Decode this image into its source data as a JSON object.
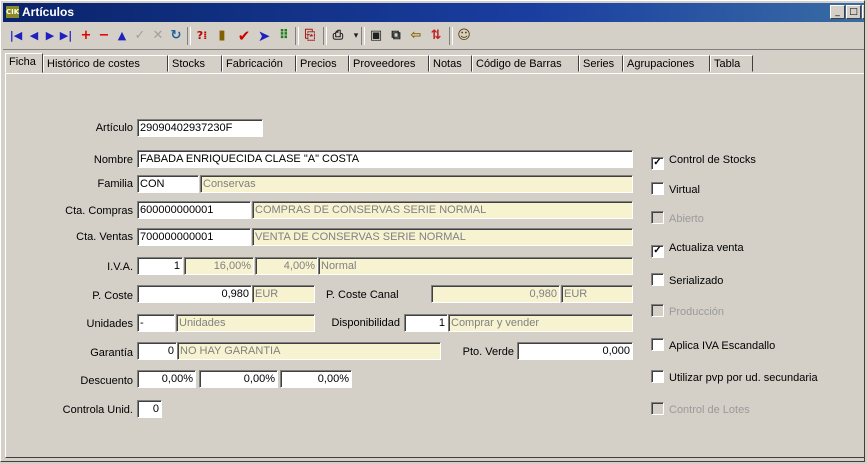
{
  "window": {
    "title": "Artículos",
    "app_icon": "CIK"
  },
  "tabs": [
    "Ficha",
    "Histórico de costes",
    "Stocks",
    "Fabricación",
    "Precios",
    "Proveedores",
    "Notas",
    "Código de Barras",
    "Series",
    "Agrupaciones",
    "Tabla"
  ],
  "form": {
    "labels": {
      "articulo": "Artículo",
      "nombre": "Nombre",
      "familia": "Familia",
      "cta_compras": "Cta. Compras",
      "cta_ventas": "Cta. Ventas",
      "iva": "I.V.A.",
      "p_coste": "P. Coste",
      "p_coste_canal": "P. Coste Canal",
      "unidades": "Unidades",
      "disponibilidad": "Disponibilidad",
      "garantia": "Garantía",
      "pto_verde": "Pto. Verde",
      "descuento": "Descuento",
      "controla_unid": "Controla Unid."
    },
    "values": {
      "articulo": "29090402937230F",
      "nombre": "FABADA ENRIQUECIDA CLASE \"A\" COSTA",
      "familia_code": "CON",
      "familia_desc": "Conservas",
      "cta_compras_code": "600000000001",
      "cta_compras_desc": "COMPRAS DE CONSERVAS SERIE NORMAL",
      "cta_ventas_code": "700000000001",
      "cta_ventas_desc": "VENTA DE CONSERVAS SERIE NORMAL",
      "iva_code": "1",
      "iva_pct": "16,00%",
      "iva_re": "4,00%",
      "iva_desc": "Normal",
      "p_coste": "0,980",
      "p_coste_currency": "EUR",
      "p_coste_canal": "0,980",
      "p_coste_canal_currency": "EUR",
      "unidades_code": "-",
      "unidades_desc": "Unidades",
      "disponibilidad_code": "1",
      "disponibilidad_desc": "Comprar y vender",
      "garantia_code": "0",
      "garantia_desc": "NO HAY GARANTIA",
      "pto_verde": "0,000",
      "descuento_1": "0,00%",
      "descuento_2": "0,00%",
      "descuento_3": "0,00%",
      "controla_unid": "0"
    }
  },
  "checkboxes": [
    {
      "label": "Control de Stocks",
      "checked": true,
      "enabled": true
    },
    {
      "label": "Virtual",
      "checked": false,
      "enabled": true
    },
    {
      "label": "Abierto",
      "checked": false,
      "enabled": false
    },
    {
      "label": "Actualiza venta",
      "checked": true,
      "enabled": true
    },
    {
      "label": "Serializado",
      "checked": false,
      "enabled": true
    },
    {
      "label": "Producción",
      "checked": false,
      "enabled": false
    },
    {
      "label": "Aplica IVA Escandallo",
      "checked": false,
      "enabled": true
    },
    {
      "label": "Utilizar pvp por ud. secundaria",
      "checked": false,
      "enabled": true
    },
    {
      "label": "Control de Lotes",
      "checked": false,
      "enabled": false
    }
  ],
  "colors": {
    "titlebar": "#0a246a",
    "readonly_field": "#f7f3d1",
    "nav_icon": "#2020c0",
    "delete_icon": "#e00000"
  }
}
